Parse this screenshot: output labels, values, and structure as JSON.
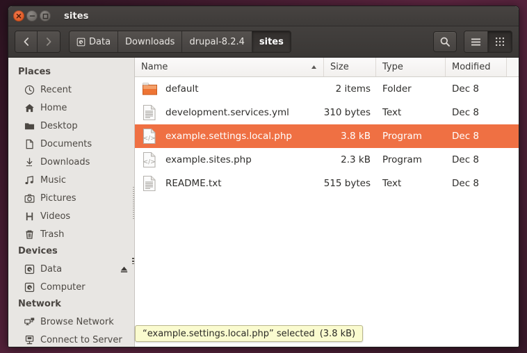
{
  "window": {
    "title": "sites",
    "controls": [
      {
        "name": "close",
        "glyph": "×"
      },
      {
        "name": "minimize",
        "glyph": "−"
      },
      {
        "name": "maximize",
        "glyph": "□"
      }
    ]
  },
  "toolbar": {
    "back_label": "Back",
    "forward_label": "Forward",
    "search_label": "Search",
    "list_view_label": "List view",
    "grid_view_label": "Icon view",
    "breadcrumbs": [
      {
        "label": "Data",
        "icon": "drive-icon",
        "active": false
      },
      {
        "label": "Downloads",
        "icon": "",
        "active": false
      },
      {
        "label": "drupal-8.2.4",
        "icon": "",
        "active": false
      },
      {
        "label": "sites",
        "icon": "",
        "active": true
      }
    ]
  },
  "sidebar": {
    "sections": [
      {
        "title": "Places",
        "items": [
          {
            "label": "Recent",
            "icon": "clock-icon",
            "eject": false
          },
          {
            "label": "Home",
            "icon": "home-icon",
            "eject": false
          },
          {
            "label": "Desktop",
            "icon": "folder-icon",
            "eject": false
          },
          {
            "label": "Documents",
            "icon": "document-icon",
            "eject": false
          },
          {
            "label": "Downloads",
            "icon": "download-icon",
            "eject": false
          },
          {
            "label": "Music",
            "icon": "music-icon",
            "eject": false
          },
          {
            "label": "Pictures",
            "icon": "camera-icon",
            "eject": false
          },
          {
            "label": "Videos",
            "icon": "film-icon",
            "eject": false
          },
          {
            "label": "Trash",
            "icon": "trash-icon",
            "eject": false
          }
        ]
      },
      {
        "title": "Devices",
        "items": [
          {
            "label": "Data",
            "icon": "drive-icon",
            "eject": true
          },
          {
            "label": "Computer",
            "icon": "drive-icon",
            "eject": false
          }
        ]
      },
      {
        "title": "Network",
        "items": [
          {
            "label": "Browse Network",
            "icon": "network-icon",
            "eject": false
          },
          {
            "label": "Connect to Server",
            "icon": "server-icon",
            "eject": false
          }
        ]
      }
    ]
  },
  "filelist": {
    "columns": [
      {
        "label": "Name",
        "sorted": true,
        "sort_direction": "asc"
      },
      {
        "label": "Size",
        "sorted": false,
        "sort_direction": ""
      },
      {
        "label": "Type",
        "sorted": false,
        "sort_direction": ""
      },
      {
        "label": "Modified",
        "sorted": false,
        "sort_direction": ""
      }
    ],
    "rows": [
      {
        "name": "default",
        "size": "2 items",
        "type": "Folder",
        "modified": "Dec 8",
        "icon": "folder-icon",
        "selected": false
      },
      {
        "name": "development.services.yml",
        "size": "310 bytes",
        "type": "Text",
        "modified": "Dec 8",
        "icon": "text-file-icon",
        "selected": false
      },
      {
        "name": "example.settings.local.php",
        "size": "3.8 kB",
        "type": "Program",
        "modified": "Dec 8",
        "icon": "code-file-icon",
        "selected": true
      },
      {
        "name": "example.sites.php",
        "size": "2.3 kB",
        "type": "Program",
        "modified": "Dec 8",
        "icon": "code-file-icon",
        "selected": false
      },
      {
        "name": "README.txt",
        "size": "515 bytes",
        "type": "Text",
        "modified": "Dec 8",
        "icon": "text-file-icon",
        "selected": false
      }
    ]
  },
  "statusbar": {
    "text": "“example.settings.local.php” selected",
    "size": "(3.8 kB)"
  },
  "colors": {
    "selection": "#ef7043",
    "folder": "#ee7434",
    "titlebar": "#403d3b",
    "sidebar": "#e8e6e3",
    "status_bg": "#fafbcf",
    "desktop": "#5c2540"
  }
}
